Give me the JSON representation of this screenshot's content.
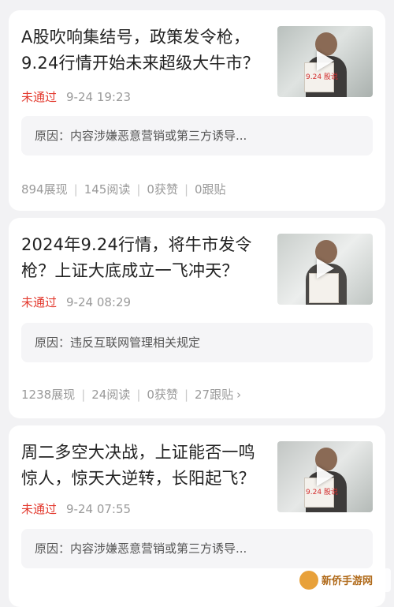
{
  "posts": [
    {
      "title": "A股吹响集结号，政策发令枪，9.24行情开始未来超级大牛市？",
      "status": "未通过",
      "time": "9-24 19:23",
      "reason": "原因：内容涉嫌恶意营销或第三方诱导...",
      "stats": {
        "views": "894展现",
        "reads": "145阅读",
        "likes": "0获赞",
        "follows": "0跟贴"
      },
      "thumb_sign": "9.24 股说"
    },
    {
      "title": "2024年9.24行情，将牛市发令枪？上证大底成立一飞冲天？",
      "status": "未通过",
      "time": "9-24 08:29",
      "reason": "原因：违反互联网管理相关规定",
      "stats": {
        "views": "1238展现",
        "reads": "24阅读",
        "likes": "0获赞",
        "follows": "27跟贴"
      },
      "thumb_sign": ""
    },
    {
      "title": "周二多空大决战，上证能否一鸣惊人，惊天大逆转，长阳起飞？",
      "status": "未通过",
      "time": "9-24 07:55",
      "reason": "原因：内容涉嫌恶意营销或第三方诱导...",
      "stats": {
        "views": "",
        "reads": "",
        "likes": "",
        "follows": ""
      },
      "thumb_sign": "9.24 股说"
    }
  ],
  "watermark": "新侨手游网",
  "colors": {
    "status_red": "#e33b30",
    "meta_gray": "#9a9a9a",
    "bg": "#f2f2f4"
  }
}
